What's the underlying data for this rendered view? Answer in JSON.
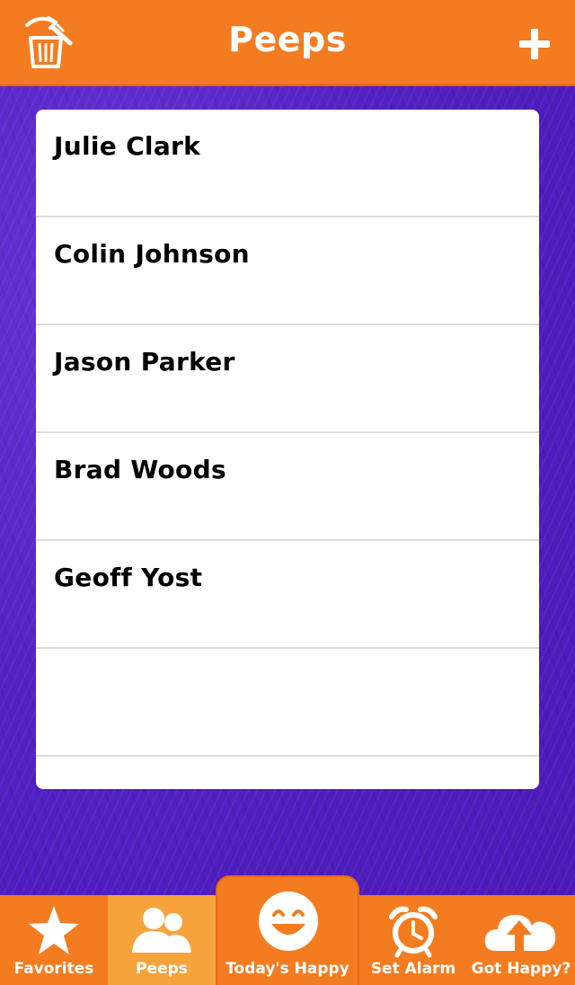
{
  "header": {
    "title": "Peeps",
    "left_icon": "trash-icon",
    "right_icon": "plus-icon"
  },
  "list": {
    "items": [
      {
        "name": "Julie Clark"
      },
      {
        "name": "Colin Johnson"
      },
      {
        "name": "Jason Parker"
      },
      {
        "name": "Brad Woods"
      },
      {
        "name": "Geoff Yost"
      },
      {
        "name": ""
      },
      {
        "name": ""
      }
    ]
  },
  "tabbar": {
    "tabs": [
      {
        "label": "Favorites",
        "icon": "star-icon",
        "active": false
      },
      {
        "label": "Peeps",
        "icon": "people-icon",
        "active": true
      },
      {
        "label": "Today's Happy",
        "icon": "smiley-icon",
        "active": false
      },
      {
        "label": "Set Alarm",
        "icon": "alarm-clock-icon",
        "active": false
      },
      {
        "label": "Got Happy?",
        "icon": "cloud-upload-icon",
        "active": false
      }
    ]
  },
  "colors": {
    "accent": "#f47c20",
    "active_tab": "#f6a33c",
    "background": "#5320c4"
  }
}
